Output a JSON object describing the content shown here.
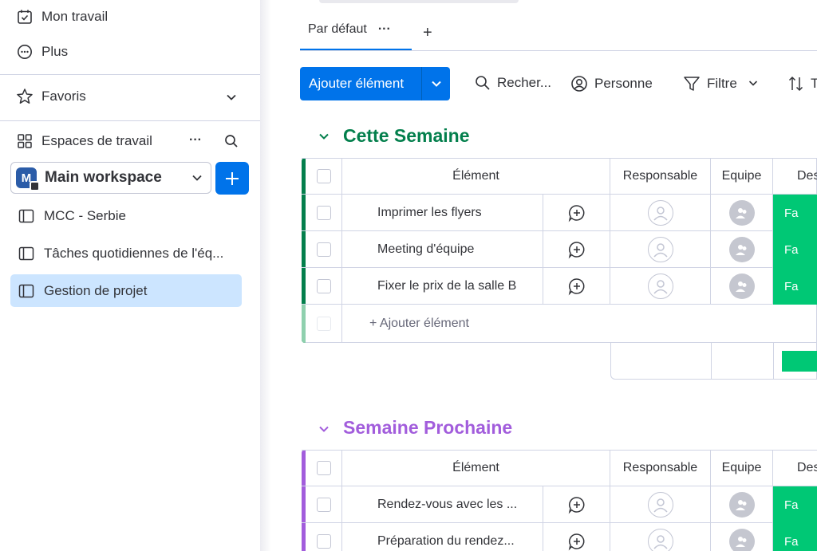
{
  "sidebar": {
    "my_work": "Mon travail",
    "more": "Plus",
    "favorites": "Favoris",
    "workspaces": "Espaces de travail",
    "workspaces_more": "···",
    "workspace_name": "Main workspace",
    "workspace_logo_letter": "M",
    "boards": [
      {
        "label": "MCC - Serbie"
      },
      {
        "label": "Tâches quotidiennes de l'éq..."
      },
      {
        "label": "Gestion de projet"
      }
    ]
  },
  "main": {
    "tab_label": "Par défaut",
    "tab_more": "···",
    "add_tab": "+",
    "add_item_button": "Ajouter élément",
    "toolbar": {
      "search": "Recher...",
      "person": "Personne",
      "filter": "Filtre",
      "sort_partial": "T"
    },
    "columns": {
      "item": "Élément",
      "owner": "Responsable",
      "team": "Equipe",
      "desc_partial": "Des"
    },
    "groups": [
      {
        "title": "Cette Semaine",
        "color": "#037f4c",
        "items": [
          {
            "name": "Imprimer les flyers",
            "status": "Fa"
          },
          {
            "name": "Meeting d'équipe",
            "status": "Fa"
          },
          {
            "name": "Fixer le prix de la salle B",
            "status": "Fa"
          }
        ],
        "add_item": "+ Ajouter élément"
      },
      {
        "title": "Semaine Prochaine",
        "color": "#a25ddc",
        "items": [
          {
            "name": "Rendez-vous avec les ...",
            "status": "Fa"
          },
          {
            "name": "Préparation du rendez...",
            "status": "Fa"
          }
        ]
      }
    ]
  },
  "colors": {
    "accent": "#0073ea",
    "status_done": "#00c875",
    "active_board_bg": "#cce5ff"
  }
}
